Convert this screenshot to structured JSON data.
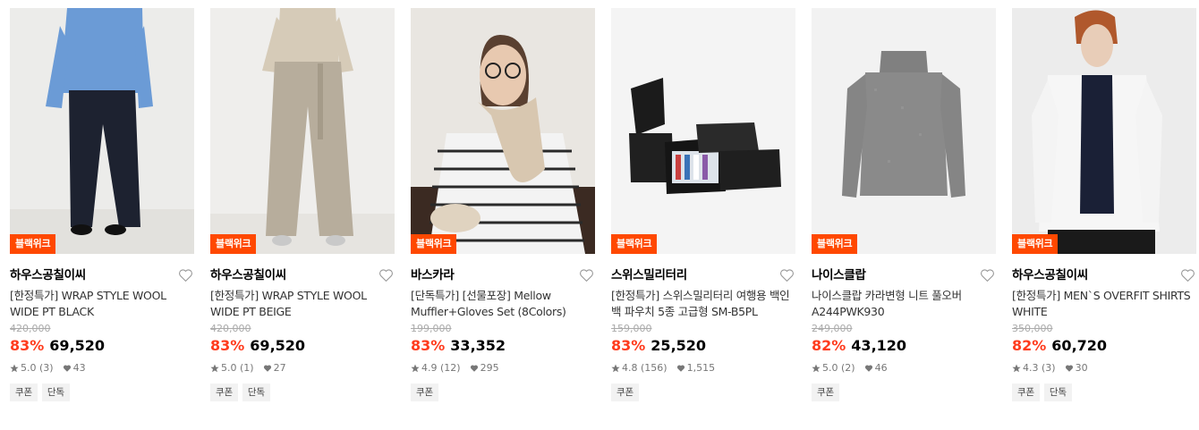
{
  "products": [
    {
      "badge": "블랙위크",
      "brand": "하우스공칠이씨",
      "name": "[한정특가] WRAP STYLE WOOL WIDE PT BLACK",
      "original_price": "420,000",
      "discount": "83%",
      "price": "69,520",
      "rating": "5.0",
      "reviews": "(3)",
      "likes": "43",
      "tags": [
        "쿠폰",
        "단독"
      ]
    },
    {
      "badge": "블랙위크",
      "brand": "하우스공칠이씨",
      "name": "[한정특가] WRAP STYLE WOOL WIDE PT BEIGE",
      "original_price": "420,000",
      "discount": "83%",
      "price": "69,520",
      "rating": "5.0",
      "reviews": "(1)",
      "likes": "27",
      "tags": [
        "쿠폰",
        "단독"
      ]
    },
    {
      "badge": "블랙위크",
      "brand": "바스카라",
      "name": "[단독특가] [선물포장] Mellow Muffler+Gloves Set (8Colors)",
      "original_price": "199,000",
      "discount": "83%",
      "price": "33,352",
      "rating": "4.9",
      "reviews": "(12)",
      "likes": "295",
      "tags": [
        "쿠폰"
      ]
    },
    {
      "badge": "블랙위크",
      "brand": "스위스밀리터리",
      "name": "[한정특가] 스위스밀리터리 여행용 백인백 파우치 5종 고급형 SM-B5PL",
      "original_price": "159,000",
      "discount": "83%",
      "price": "25,520",
      "rating": "4.8",
      "reviews": "(156)",
      "likes": "1,515",
      "tags": [
        "쿠폰"
      ]
    },
    {
      "badge": "블랙위크",
      "brand": "나이스클랍",
      "name": "나이스클랍 카라변형 니트 풀오버 A244PWK930",
      "original_price": "249,000",
      "discount": "82%",
      "price": "43,120",
      "rating": "5.0",
      "reviews": "(2)",
      "likes": "46",
      "tags": [
        "쿠폰"
      ]
    },
    {
      "badge": "블랙위크",
      "brand": "하우스공칠이씨",
      "name": "[한정특가] MEN`S OVERFIT SHIRTS WHITE",
      "original_price": "350,000",
      "discount": "82%",
      "price": "60,720",
      "rating": "4.3",
      "reviews": "(3)",
      "likes": "30",
      "tags": [
        "쿠폰",
        "단독"
      ]
    }
  ],
  "icons": {
    "wishlist": "heart-outline-icon",
    "rating": "star-icon",
    "likes": "heart-filled-icon"
  },
  "colors": {
    "badge": "#ff4800",
    "discount": "#ff3c1e"
  }
}
